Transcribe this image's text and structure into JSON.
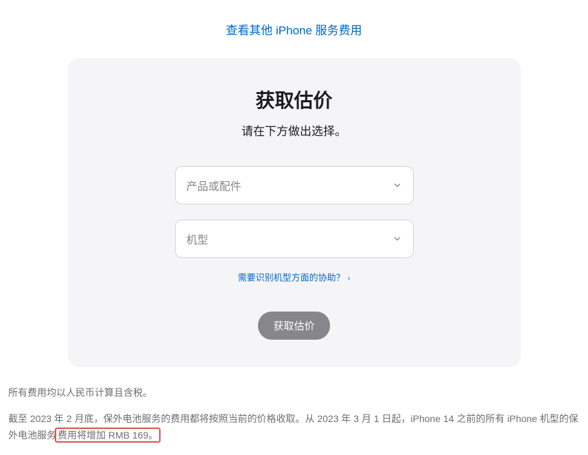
{
  "topLink": {
    "label": "查看其他 iPhone 服务费用"
  },
  "card": {
    "title": "获取估价",
    "subtitle": "请在下方做出选择。",
    "select1": {
      "placeholder": "产品或配件"
    },
    "select2": {
      "placeholder": "机型"
    },
    "helpLink": {
      "label": "需要识别机型方面的协助？"
    },
    "button": {
      "label": "获取估价"
    }
  },
  "footer": {
    "line1": "所有费用均以人民币计算且含税。",
    "line2_part1": "截至 2023 年 2 月底，保外电池服务的费用都将按照当前的价格收取。从 2023 年 3 月 1 日起，iPhone 14 之前的所有 iPhone 机型的保外电池服务",
    "line2_highlight": "费用将增加 RMB 169。"
  }
}
